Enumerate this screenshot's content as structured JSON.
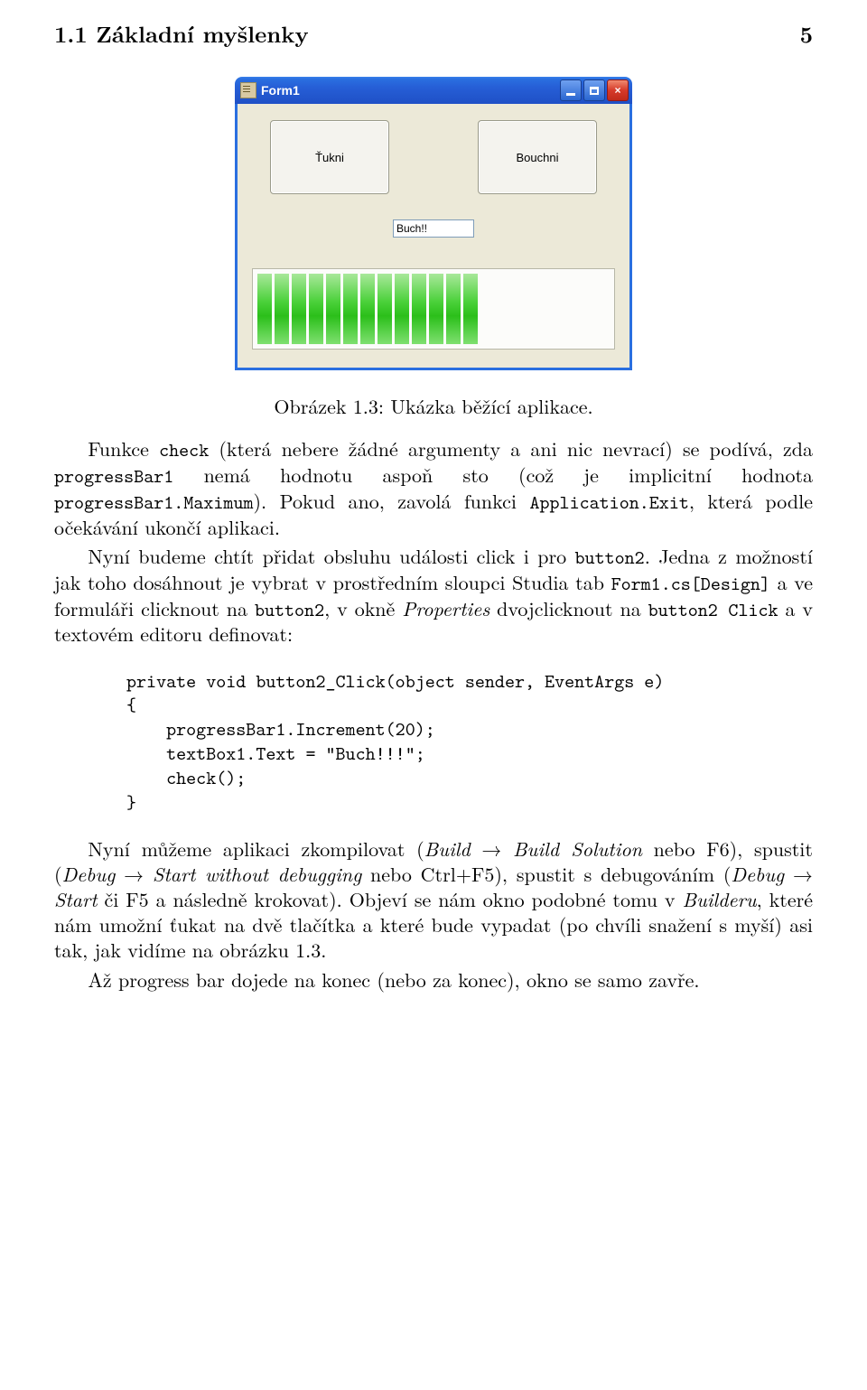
{
  "header": {
    "section": "1.1 Základní myšlenky",
    "page_number": "5"
  },
  "figure": {
    "window_title": "Form1",
    "button1": "Ťukni",
    "button2": "Bouchni",
    "textbox_value": "Buch!!",
    "progress_segments": 13,
    "caption": "Obrázek 1.3: Ukázka běžící aplikace."
  },
  "para1": {
    "t1": "Funkce ",
    "c1": "check",
    "t2": " (která nebere žádné argumenty a ani nic nevrací) se podívá, zda ",
    "c2": "progressBar1",
    "t3": " nemá hodnotu aspoň sto (což je implicitní hodnota ",
    "c3": "progressBar1.Maximum",
    "t4": "). Pokud ano, zavolá funkci ",
    "c4": "Application.Exit",
    "t5": ", která podle očekávání ukončí aplikaci."
  },
  "para2": {
    "t1": "Nyní budeme chtít přidat obsluhu události click i pro ",
    "c1": "button2",
    "t2": ". Jedna z možností jak toho dosáhnout je vybrat v prostředním sloupci Studia tab ",
    "c2": "Form1.cs[Design]",
    "t3": " a ve formuláři clicknout na ",
    "c3": "button2",
    "t4": ", v okně ",
    "i1": "Properties",
    "t5": " dvojclicknout na ",
    "c4": "button2 Click",
    "t6": " a v textovém editoru definovat:"
  },
  "code": "private void button2_Click(object sender, EventArgs e)\n{\n    progressBar1.Increment(20);\n    textBox1.Text = \"Buch!!!\";\n    check();\n}",
  "para3": {
    "t1": "Nyní můžeme aplikaci zkompilovat (",
    "i1": "Build",
    "arr1": " → ",
    "i2": "Build Solution",
    "t2": " nebo F6), spustit (",
    "i3": "Debug",
    "arr2": " → ",
    "i4": "Start without debugging",
    "t3": " nebo Ctrl+F5), spustit s debugováním (",
    "i5": "Debug",
    "arr3": " → ",
    "i6": "Start",
    "t4": " či F5 a následně krokovat). Objeví se nám okno podobné tomu v ",
    "i7": "Builderu",
    "t5": ", které nám umožní ťukat na dvě tlačítka a které bude vypadat (po chvíli snažení s myší) asi tak, jak vidíme na obrázku 1.3."
  },
  "para4": "Až progress bar dojede na konec (nebo za konec), okno se samo zavře."
}
